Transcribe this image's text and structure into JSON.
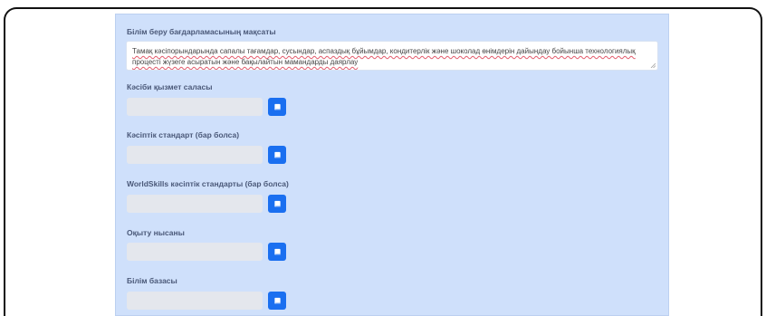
{
  "form": {
    "goal": {
      "label": "Білім беру бағдарламасының мақсаты",
      "value": "Тамақ кәсіпорындарында сапалы тағамдар, сусындар, аспаздық бұйымдар, кондитерлік және шоколад өнімдерін дайындау бойынша технологиялық процесті жүзеге асыратын және бақылайтын мамандарды даярлау"
    },
    "fields": [
      {
        "label": "Кәсіби қызмет саласы",
        "value": "",
        "button_icon": "book-icon"
      },
      {
        "label": "Кәсіптік стандарт (бар болса)",
        "value": "",
        "button_icon": "book-icon"
      },
      {
        "label": "WorldSkills кәсіптік стандарты (бар болса)",
        "value": "",
        "button_icon": "book-icon"
      },
      {
        "label": "Оқыту нысаны",
        "value": "",
        "button_icon": "book-icon"
      },
      {
        "label": "Білім базасы",
        "value": "",
        "button_icon": "book-icon"
      }
    ]
  },
  "colors": {
    "panel_bg": "#cfe0fb",
    "button_bg": "#1a6ff0",
    "input_bg": "#e4e7ed",
    "label_text": "#4a5878"
  }
}
